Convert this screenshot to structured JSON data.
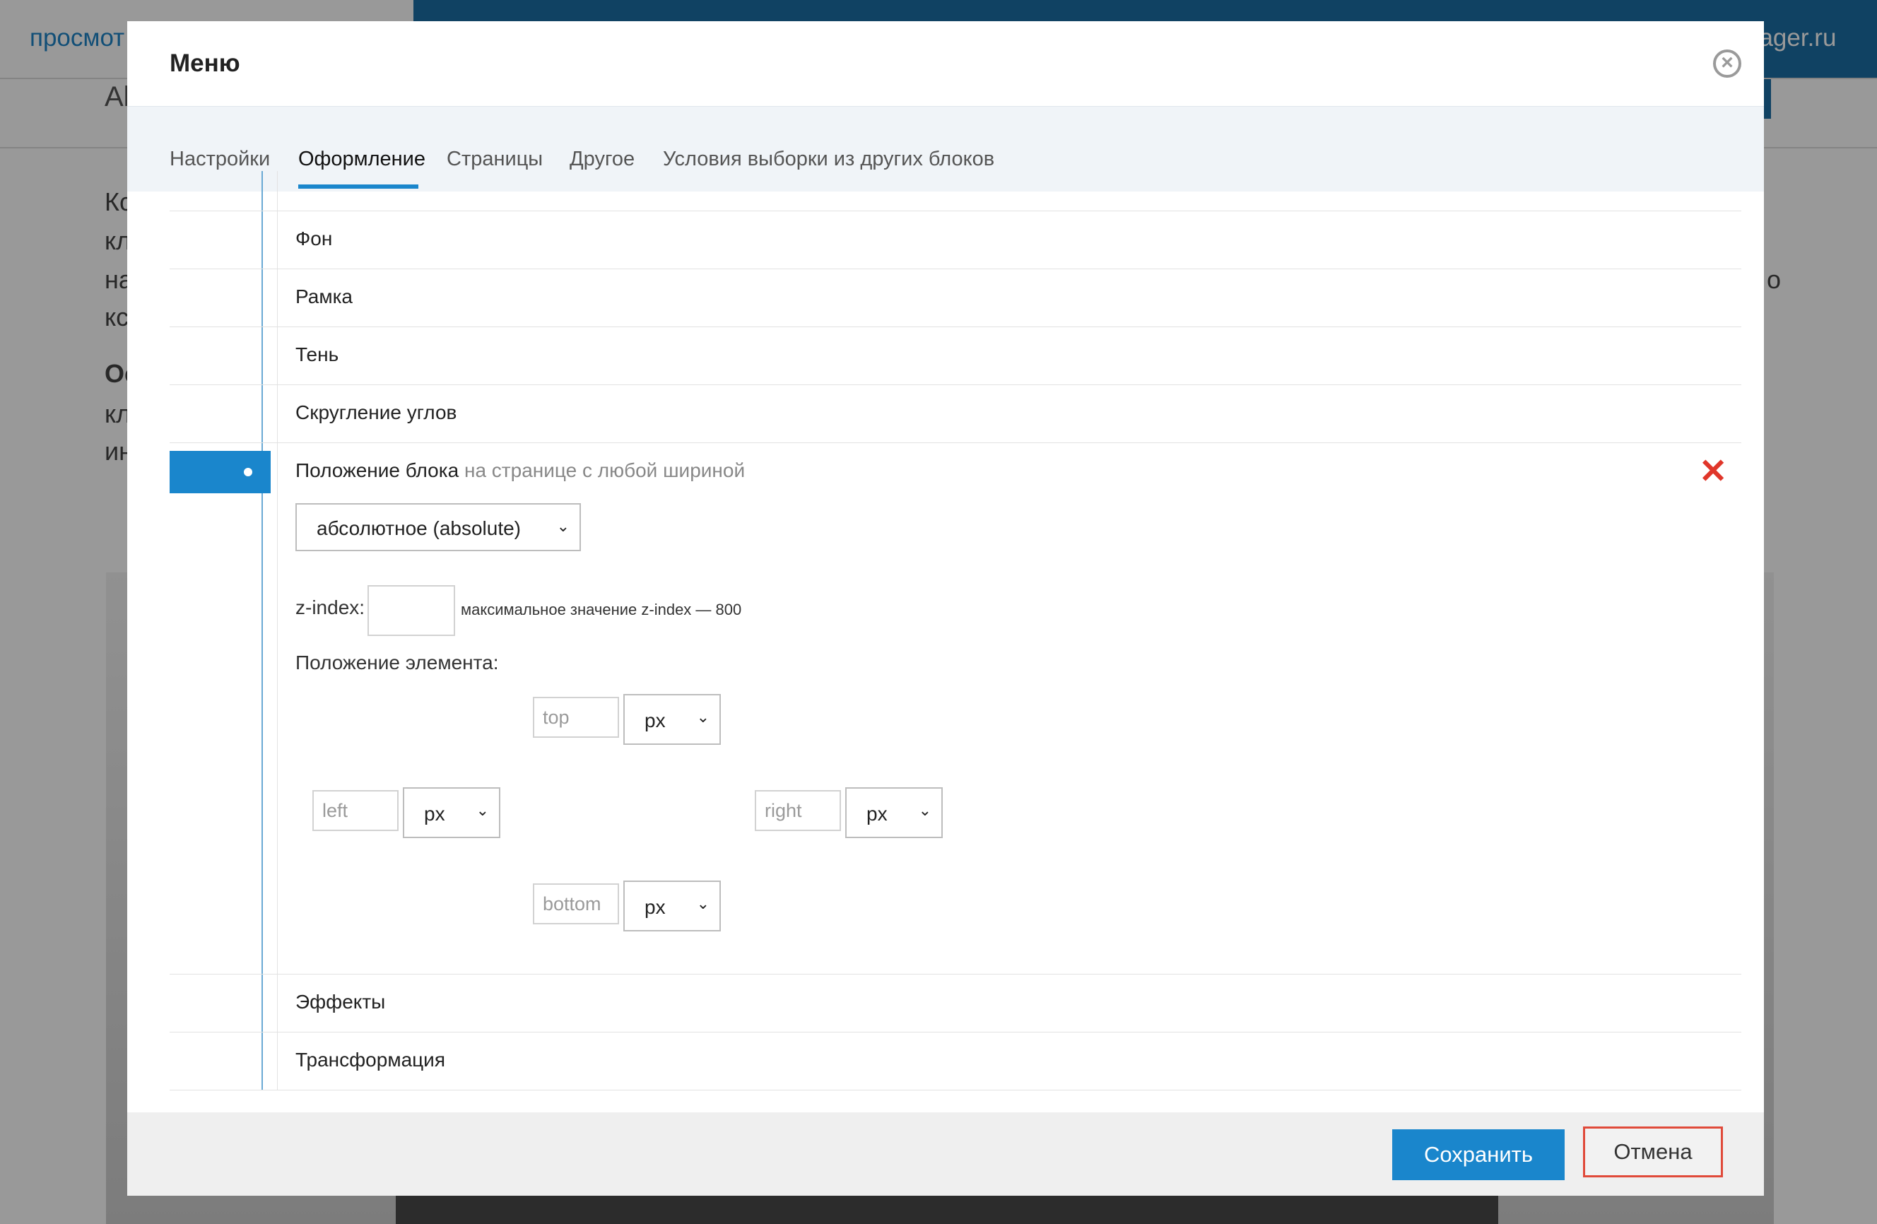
{
  "background": {
    "view_link": "просмот",
    "manager_link": "nager.ru",
    "sub_text": "Al",
    "text_lines": [
      "Кс",
      "кл",
      "на",
      "кс",
      "Ос",
      "кл",
      "ин"
    ],
    "right_fragment": "о"
  },
  "modal": {
    "title": "Меню",
    "tabs": [
      {
        "label": "Настройки",
        "active": false
      },
      {
        "label": "Оформление",
        "active": true
      },
      {
        "label": "Страницы",
        "active": false
      },
      {
        "label": "Другое",
        "active": false
      },
      {
        "label": "Условия выборки из других блоков",
        "active": false
      }
    ],
    "sections": {
      "background": "Фон",
      "border": "Рамка",
      "shadow": "Тень",
      "rounding": "Скругление углов",
      "position": "Положение блока",
      "position_note": "на странице с любой шириной",
      "effects": "Эффекты",
      "transform": "Трансформация"
    },
    "position_panel": {
      "mode_selected": "абсолютное (absolute)",
      "zindex_label": "z-index:",
      "zindex_value": "",
      "zindex_note": "максимальное значение z-index — 800",
      "element_position_label": "Положение элемента:",
      "top": {
        "placeholder": "top",
        "unit": "px"
      },
      "left": {
        "placeholder": "left",
        "unit": "px"
      },
      "right": {
        "placeholder": "right",
        "unit": "px"
      },
      "bottom": {
        "placeholder": "bottom",
        "unit": "px"
      }
    },
    "footer": {
      "save_label": "Сохранить",
      "cancel_label": "Отмена"
    }
  },
  "colors": {
    "accent": "#1a86cc",
    "danger": "#e0362a",
    "cancel_border": "#e04a3a"
  }
}
